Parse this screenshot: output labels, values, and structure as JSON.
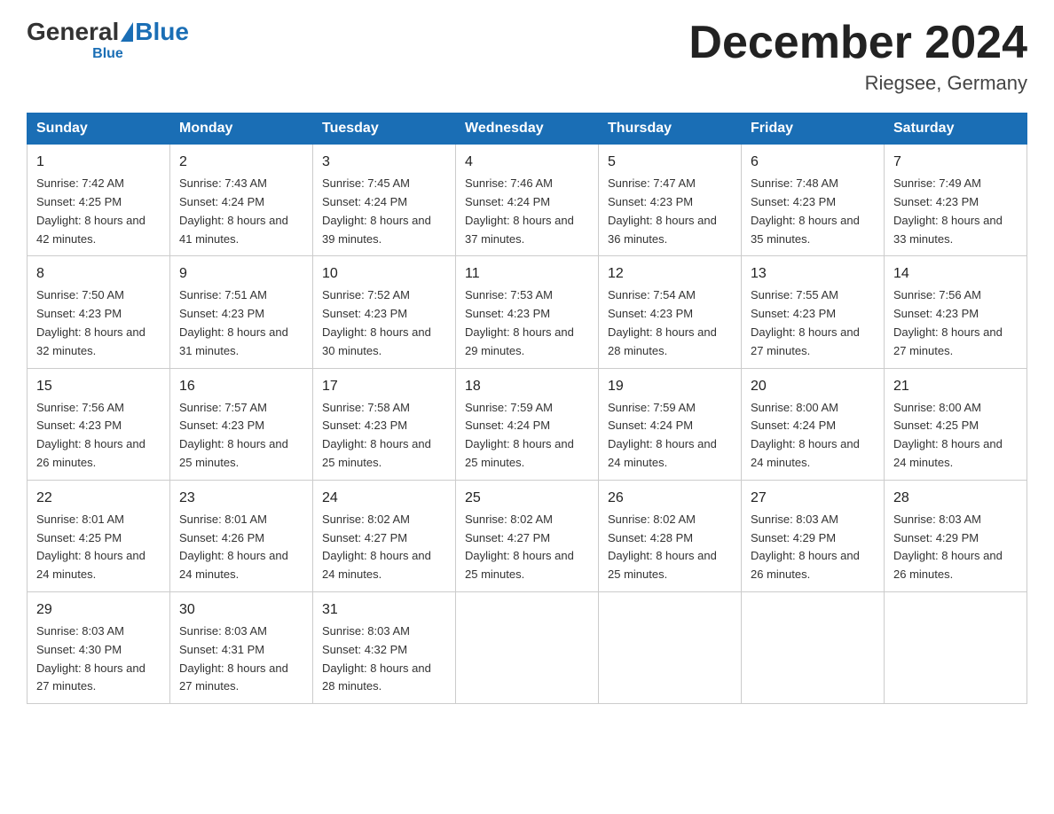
{
  "header": {
    "logo": {
      "general": "General",
      "blue": "Blue",
      "subtitle": "Blue"
    },
    "title": "December 2024",
    "location": "Riegsee, Germany"
  },
  "days_of_week": [
    "Sunday",
    "Monday",
    "Tuesday",
    "Wednesday",
    "Thursday",
    "Friday",
    "Saturday"
  ],
  "weeks": [
    [
      {
        "num": "1",
        "sunrise": "7:42 AM",
        "sunset": "4:25 PM",
        "daylight": "8 hours and 42 minutes."
      },
      {
        "num": "2",
        "sunrise": "7:43 AM",
        "sunset": "4:24 PM",
        "daylight": "8 hours and 41 minutes."
      },
      {
        "num": "3",
        "sunrise": "7:45 AM",
        "sunset": "4:24 PM",
        "daylight": "8 hours and 39 minutes."
      },
      {
        "num": "4",
        "sunrise": "7:46 AM",
        "sunset": "4:24 PM",
        "daylight": "8 hours and 37 minutes."
      },
      {
        "num": "5",
        "sunrise": "7:47 AM",
        "sunset": "4:23 PM",
        "daylight": "8 hours and 36 minutes."
      },
      {
        "num": "6",
        "sunrise": "7:48 AM",
        "sunset": "4:23 PM",
        "daylight": "8 hours and 35 minutes."
      },
      {
        "num": "7",
        "sunrise": "7:49 AM",
        "sunset": "4:23 PM",
        "daylight": "8 hours and 33 minutes."
      }
    ],
    [
      {
        "num": "8",
        "sunrise": "7:50 AM",
        "sunset": "4:23 PM",
        "daylight": "8 hours and 32 minutes."
      },
      {
        "num": "9",
        "sunrise": "7:51 AM",
        "sunset": "4:23 PM",
        "daylight": "8 hours and 31 minutes."
      },
      {
        "num": "10",
        "sunrise": "7:52 AM",
        "sunset": "4:23 PM",
        "daylight": "8 hours and 30 minutes."
      },
      {
        "num": "11",
        "sunrise": "7:53 AM",
        "sunset": "4:23 PM",
        "daylight": "8 hours and 29 minutes."
      },
      {
        "num": "12",
        "sunrise": "7:54 AM",
        "sunset": "4:23 PM",
        "daylight": "8 hours and 28 minutes."
      },
      {
        "num": "13",
        "sunrise": "7:55 AM",
        "sunset": "4:23 PM",
        "daylight": "8 hours and 27 minutes."
      },
      {
        "num": "14",
        "sunrise": "7:56 AM",
        "sunset": "4:23 PM",
        "daylight": "8 hours and 27 minutes."
      }
    ],
    [
      {
        "num": "15",
        "sunrise": "7:56 AM",
        "sunset": "4:23 PM",
        "daylight": "8 hours and 26 minutes."
      },
      {
        "num": "16",
        "sunrise": "7:57 AM",
        "sunset": "4:23 PM",
        "daylight": "8 hours and 25 minutes."
      },
      {
        "num": "17",
        "sunrise": "7:58 AM",
        "sunset": "4:23 PM",
        "daylight": "8 hours and 25 minutes."
      },
      {
        "num": "18",
        "sunrise": "7:59 AM",
        "sunset": "4:24 PM",
        "daylight": "8 hours and 25 minutes."
      },
      {
        "num": "19",
        "sunrise": "7:59 AM",
        "sunset": "4:24 PM",
        "daylight": "8 hours and 24 minutes."
      },
      {
        "num": "20",
        "sunrise": "8:00 AM",
        "sunset": "4:24 PM",
        "daylight": "8 hours and 24 minutes."
      },
      {
        "num": "21",
        "sunrise": "8:00 AM",
        "sunset": "4:25 PM",
        "daylight": "8 hours and 24 minutes."
      }
    ],
    [
      {
        "num": "22",
        "sunrise": "8:01 AM",
        "sunset": "4:25 PM",
        "daylight": "8 hours and 24 minutes."
      },
      {
        "num": "23",
        "sunrise": "8:01 AM",
        "sunset": "4:26 PM",
        "daylight": "8 hours and 24 minutes."
      },
      {
        "num": "24",
        "sunrise": "8:02 AM",
        "sunset": "4:27 PM",
        "daylight": "8 hours and 24 minutes."
      },
      {
        "num": "25",
        "sunrise": "8:02 AM",
        "sunset": "4:27 PM",
        "daylight": "8 hours and 25 minutes."
      },
      {
        "num": "26",
        "sunrise": "8:02 AM",
        "sunset": "4:28 PM",
        "daylight": "8 hours and 25 minutes."
      },
      {
        "num": "27",
        "sunrise": "8:03 AM",
        "sunset": "4:29 PM",
        "daylight": "8 hours and 26 minutes."
      },
      {
        "num": "28",
        "sunrise": "8:03 AM",
        "sunset": "4:29 PM",
        "daylight": "8 hours and 26 minutes."
      }
    ],
    [
      {
        "num": "29",
        "sunrise": "8:03 AM",
        "sunset": "4:30 PM",
        "daylight": "8 hours and 27 minutes."
      },
      {
        "num": "30",
        "sunrise": "8:03 AM",
        "sunset": "4:31 PM",
        "daylight": "8 hours and 27 minutes."
      },
      {
        "num": "31",
        "sunrise": "8:03 AM",
        "sunset": "4:32 PM",
        "daylight": "8 hours and 28 minutes."
      },
      null,
      null,
      null,
      null
    ]
  ]
}
